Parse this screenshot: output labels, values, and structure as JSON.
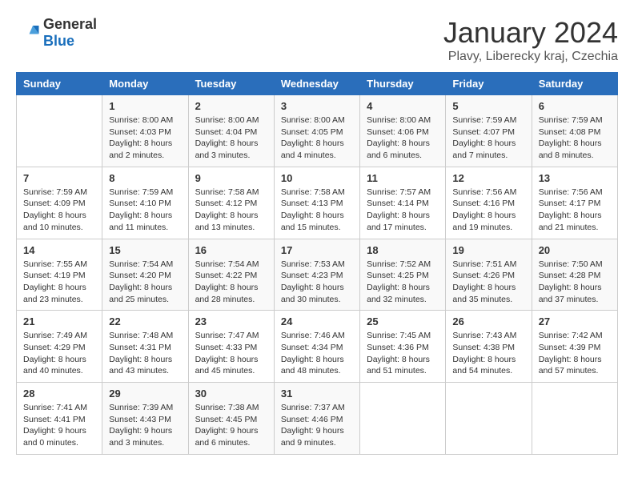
{
  "logo": {
    "general": "General",
    "blue": "Blue"
  },
  "title": "January 2024",
  "subtitle": "Plavy, Liberecky kraj, Czechia",
  "days_of_week": [
    "Sunday",
    "Monday",
    "Tuesday",
    "Wednesday",
    "Thursday",
    "Friday",
    "Saturday"
  ],
  "weeks": [
    [
      {
        "day": "",
        "info": ""
      },
      {
        "day": "1",
        "info": "Sunrise: 8:00 AM\nSunset: 4:03 PM\nDaylight: 8 hours\nand 2 minutes."
      },
      {
        "day": "2",
        "info": "Sunrise: 8:00 AM\nSunset: 4:04 PM\nDaylight: 8 hours\nand 3 minutes."
      },
      {
        "day": "3",
        "info": "Sunrise: 8:00 AM\nSunset: 4:05 PM\nDaylight: 8 hours\nand 4 minutes."
      },
      {
        "day": "4",
        "info": "Sunrise: 8:00 AM\nSunset: 4:06 PM\nDaylight: 8 hours\nand 6 minutes."
      },
      {
        "day": "5",
        "info": "Sunrise: 7:59 AM\nSunset: 4:07 PM\nDaylight: 8 hours\nand 7 minutes."
      },
      {
        "day": "6",
        "info": "Sunrise: 7:59 AM\nSunset: 4:08 PM\nDaylight: 8 hours\nand 8 minutes."
      }
    ],
    [
      {
        "day": "7",
        "info": "Sunrise: 7:59 AM\nSunset: 4:09 PM\nDaylight: 8 hours\nand 10 minutes."
      },
      {
        "day": "8",
        "info": "Sunrise: 7:59 AM\nSunset: 4:10 PM\nDaylight: 8 hours\nand 11 minutes."
      },
      {
        "day": "9",
        "info": "Sunrise: 7:58 AM\nSunset: 4:12 PM\nDaylight: 8 hours\nand 13 minutes."
      },
      {
        "day": "10",
        "info": "Sunrise: 7:58 AM\nSunset: 4:13 PM\nDaylight: 8 hours\nand 15 minutes."
      },
      {
        "day": "11",
        "info": "Sunrise: 7:57 AM\nSunset: 4:14 PM\nDaylight: 8 hours\nand 17 minutes."
      },
      {
        "day": "12",
        "info": "Sunrise: 7:56 AM\nSunset: 4:16 PM\nDaylight: 8 hours\nand 19 minutes."
      },
      {
        "day": "13",
        "info": "Sunrise: 7:56 AM\nSunset: 4:17 PM\nDaylight: 8 hours\nand 21 minutes."
      }
    ],
    [
      {
        "day": "14",
        "info": "Sunrise: 7:55 AM\nSunset: 4:19 PM\nDaylight: 8 hours\nand 23 minutes."
      },
      {
        "day": "15",
        "info": "Sunrise: 7:54 AM\nSunset: 4:20 PM\nDaylight: 8 hours\nand 25 minutes."
      },
      {
        "day": "16",
        "info": "Sunrise: 7:54 AM\nSunset: 4:22 PM\nDaylight: 8 hours\nand 28 minutes."
      },
      {
        "day": "17",
        "info": "Sunrise: 7:53 AM\nSunset: 4:23 PM\nDaylight: 8 hours\nand 30 minutes."
      },
      {
        "day": "18",
        "info": "Sunrise: 7:52 AM\nSunset: 4:25 PM\nDaylight: 8 hours\nand 32 minutes."
      },
      {
        "day": "19",
        "info": "Sunrise: 7:51 AM\nSunset: 4:26 PM\nDaylight: 8 hours\nand 35 minutes."
      },
      {
        "day": "20",
        "info": "Sunrise: 7:50 AM\nSunset: 4:28 PM\nDaylight: 8 hours\nand 37 minutes."
      }
    ],
    [
      {
        "day": "21",
        "info": "Sunrise: 7:49 AM\nSunset: 4:29 PM\nDaylight: 8 hours\nand 40 minutes."
      },
      {
        "day": "22",
        "info": "Sunrise: 7:48 AM\nSunset: 4:31 PM\nDaylight: 8 hours\nand 43 minutes."
      },
      {
        "day": "23",
        "info": "Sunrise: 7:47 AM\nSunset: 4:33 PM\nDaylight: 8 hours\nand 45 minutes."
      },
      {
        "day": "24",
        "info": "Sunrise: 7:46 AM\nSunset: 4:34 PM\nDaylight: 8 hours\nand 48 minutes."
      },
      {
        "day": "25",
        "info": "Sunrise: 7:45 AM\nSunset: 4:36 PM\nDaylight: 8 hours\nand 51 minutes."
      },
      {
        "day": "26",
        "info": "Sunrise: 7:43 AM\nSunset: 4:38 PM\nDaylight: 8 hours\nand 54 minutes."
      },
      {
        "day": "27",
        "info": "Sunrise: 7:42 AM\nSunset: 4:39 PM\nDaylight: 8 hours\nand 57 minutes."
      }
    ],
    [
      {
        "day": "28",
        "info": "Sunrise: 7:41 AM\nSunset: 4:41 PM\nDaylight: 9 hours\nand 0 minutes."
      },
      {
        "day": "29",
        "info": "Sunrise: 7:39 AM\nSunset: 4:43 PM\nDaylight: 9 hours\nand 3 minutes."
      },
      {
        "day": "30",
        "info": "Sunrise: 7:38 AM\nSunset: 4:45 PM\nDaylight: 9 hours\nand 6 minutes."
      },
      {
        "day": "31",
        "info": "Sunrise: 7:37 AM\nSunset: 4:46 PM\nDaylight: 9 hours\nand 9 minutes."
      },
      {
        "day": "",
        "info": ""
      },
      {
        "day": "",
        "info": ""
      },
      {
        "day": "",
        "info": ""
      }
    ]
  ]
}
